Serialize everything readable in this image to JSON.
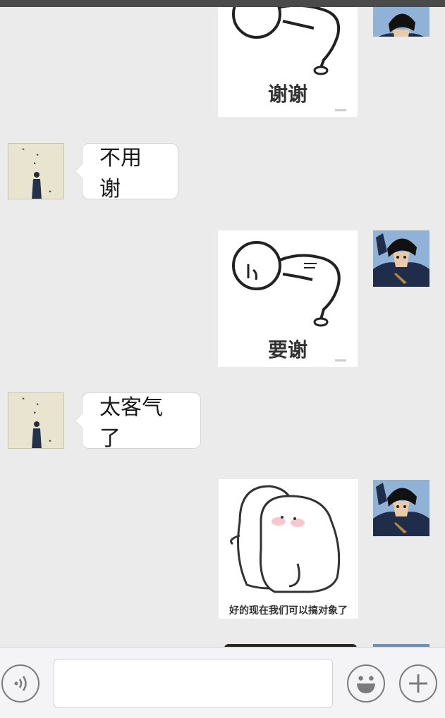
{
  "chat": {
    "messages": [
      {
        "sender": "me",
        "type": "sticker",
        "sticker": "bowing-figure-sticker",
        "caption": "谢谢"
      },
      {
        "sender": "friend",
        "type": "text",
        "text": "不用谢"
      },
      {
        "sender": "me",
        "type": "sticker",
        "sticker": "bowing-figure-sticker",
        "caption": "要谢"
      },
      {
        "sender": "friend",
        "type": "text",
        "text": "太客气了"
      },
      {
        "sender": "me",
        "type": "sticker",
        "sticker": "hugging-blobs-sticker",
        "caption": "好的现在我们可以搞对象了"
      },
      {
        "sender": "me",
        "type": "sticker",
        "sticker": "dark-sticker-partial",
        "caption": ""
      }
    ]
  },
  "input_bar": {
    "voice_icon": "voice-wave-icon",
    "emoji_icon": "smiley-face-icon",
    "more_icon": "plus-icon",
    "text_value": ""
  },
  "colors": {
    "background": "#ebebeb",
    "bubble": "#ffffff",
    "status_bar": "#4a4a4a",
    "input_bar": "#f4f4f6"
  }
}
